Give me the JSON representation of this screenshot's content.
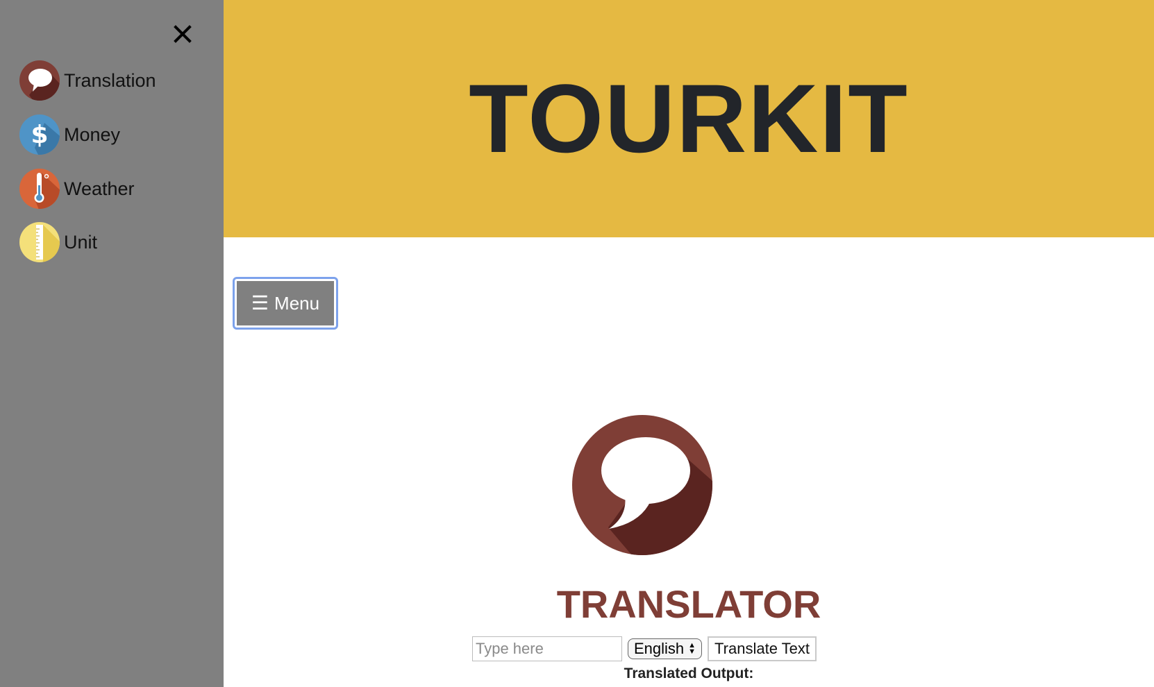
{
  "sidebar": {
    "close_icon": "close-icon",
    "items": [
      {
        "label": "Translation",
        "icon": "speech-bubble-icon",
        "color": "#7f3e36"
      },
      {
        "label": "Money",
        "icon": "dollar-icon",
        "color": "#4f94c7"
      },
      {
        "label": "Weather",
        "icon": "thermometer-icon",
        "color": "#d9663a"
      },
      {
        "label": "Unit",
        "icon": "ruler-icon",
        "color": "#f4e07a"
      }
    ],
    "background": "#808080"
  },
  "header": {
    "title": "TOURKIT",
    "background": "#e5b942"
  },
  "menu_button": {
    "label": "Menu",
    "icon": "hamburger-icon"
  },
  "main": {
    "logo_icon": "speech-bubble-icon",
    "title": "TRANSLATOR",
    "title_color": "#7f3e36",
    "input": {
      "value": "",
      "placeholder": "Type here"
    },
    "language_select": {
      "selected": "English"
    },
    "translate_button": "Translate Text",
    "output_label": "Translated Output:"
  }
}
